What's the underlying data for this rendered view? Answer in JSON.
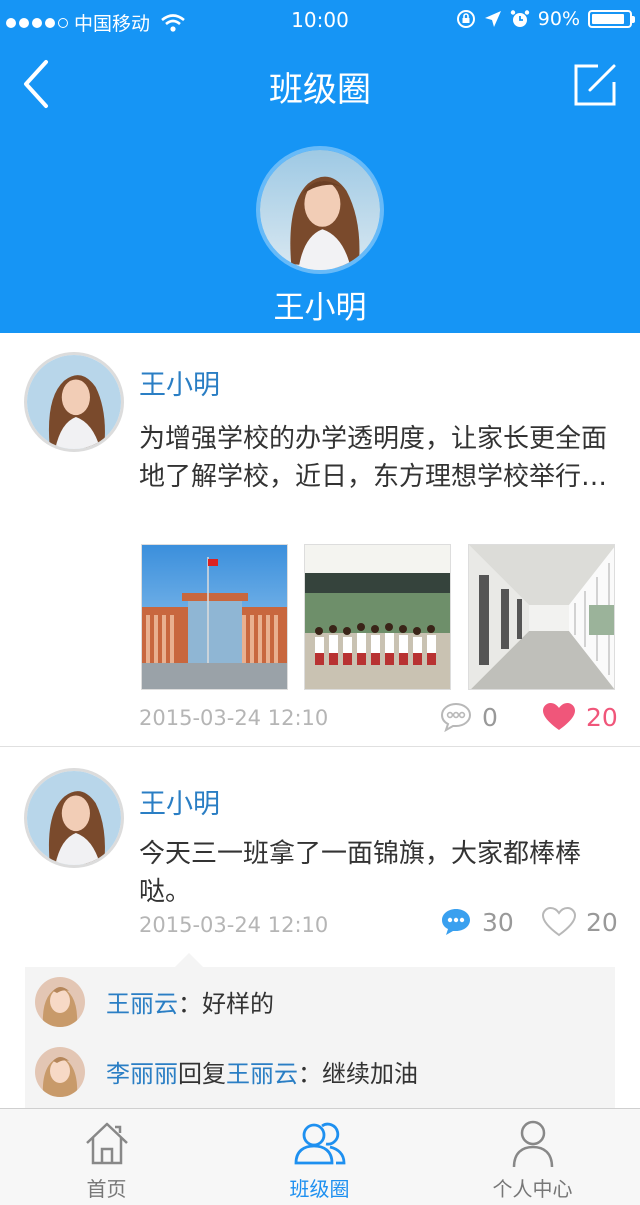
{
  "status_bar": {
    "carrier": "中国移动",
    "time": "10:00",
    "battery": "90%"
  },
  "nav": {
    "title": "班级圈"
  },
  "profile": {
    "name": "王小明"
  },
  "posts": [
    {
      "author": "王小明",
      "text": "为增强学校的办学透明度，让家长更全面地了解学校，近日，东方理想学校举行…",
      "photos": [
        "school-building-photo",
        "students-group-photo",
        "corridor-photo"
      ],
      "datetime": "2015-03-24  12:10",
      "comments": "0",
      "likes": "20",
      "liked": true
    },
    {
      "author": "王小明",
      "text": "今天三一班拿了一面锦旗，大家都棒棒哒。",
      "datetime": "2015-03-24  12:10",
      "comments": "30",
      "likes": "20",
      "liked": false,
      "replies": [
        {
          "name": "王丽云",
          "sep": "：",
          "text": "好样的"
        },
        {
          "name": "李丽丽",
          "verb": "回复",
          "target": "王丽云",
          "sep": "：",
          "text": "继续加油"
        }
      ]
    }
  ],
  "tabs": [
    {
      "label": "首页",
      "icon": "home-icon"
    },
    {
      "label": "班级圈",
      "icon": "class-circle-icon",
      "active": true
    },
    {
      "label": "个人中心",
      "icon": "person-icon"
    }
  ],
  "colors": {
    "primary": "#1695f5",
    "link": "#2a7ec4",
    "like": "#f0567a"
  }
}
